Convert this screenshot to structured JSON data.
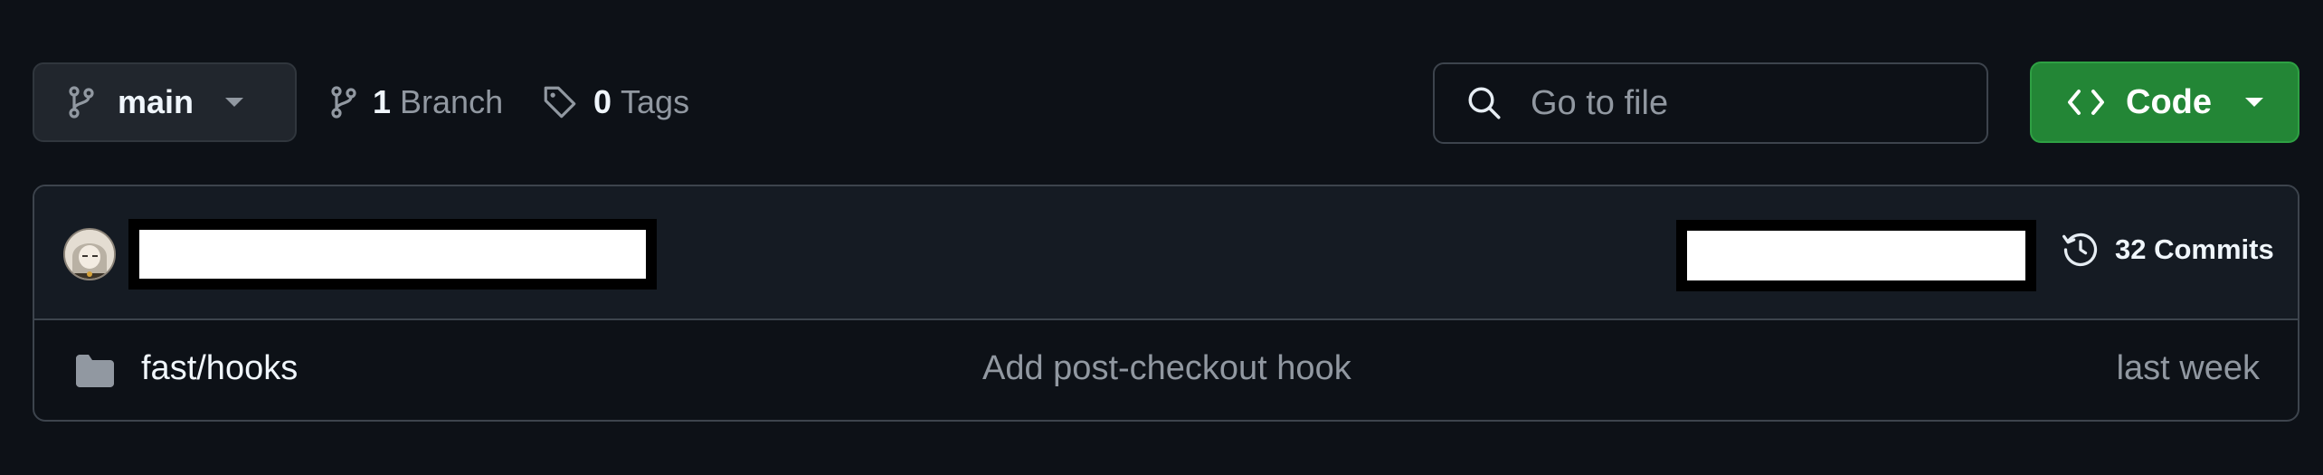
{
  "branch_selector": {
    "name": "main"
  },
  "branches": {
    "count": "1",
    "label": "Branch"
  },
  "tags": {
    "count": "0",
    "label": "Tags"
  },
  "search": {
    "placeholder": "Go to file",
    "value": ""
  },
  "code_button": {
    "label": "Code"
  },
  "latest_commit": {
    "commit_count": "32 Commits"
  },
  "files": [
    {
      "type": "folder",
      "name": "fast/hooks",
      "message": "Add post-checkout hook",
      "time": "last week"
    }
  ],
  "colors": {
    "background": "#0d1117",
    "code_button": "#238636",
    "muted_text": "#9198a1"
  },
  "icons": [
    "git-branch-icon",
    "caret-down-icon",
    "tag-icon",
    "search-icon",
    "code-icon",
    "history-icon",
    "folder-icon"
  ]
}
